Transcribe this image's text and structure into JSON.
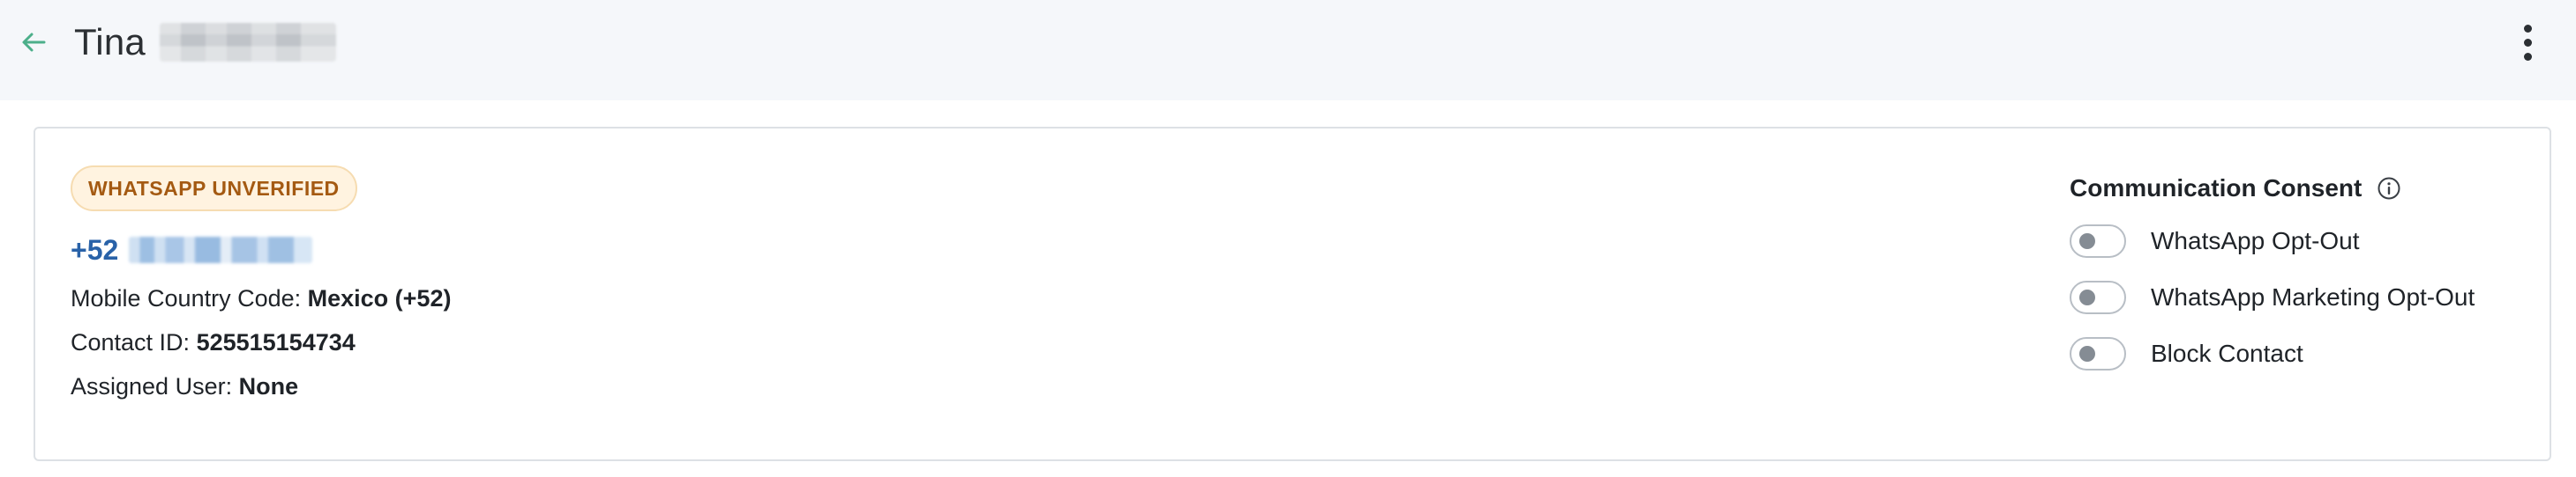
{
  "header": {
    "first_name": "Tina",
    "back_icon": "arrow-left-icon",
    "menu_icon": "more-vertical-icon",
    "accent_color": "#4caf8a"
  },
  "contact": {
    "status_badge": "WHATSAPP UNVERIFIED",
    "phone_prefix": "+52",
    "fields": {
      "mobile_country_code_label": "Mobile Country Code:",
      "mobile_country_code_value": "Mexico (+52)",
      "contact_id_label": "Contact ID:",
      "contact_id_value": "525515154734",
      "assigned_user_label": "Assigned User:",
      "assigned_user_value": "None"
    }
  },
  "consent": {
    "title": "Communication Consent",
    "info_icon": "info-circle-icon",
    "toggles": [
      {
        "label": "WhatsApp Opt-Out",
        "checked": false
      },
      {
        "label": "WhatsApp Marketing Opt-Out",
        "checked": false
      },
      {
        "label": "Block Contact",
        "checked": false
      }
    ]
  },
  "colors": {
    "header_bg": "#f5f7fa",
    "badge_bg": "#fff3e0",
    "badge_text": "#a45a12",
    "phone_link": "#2962a8"
  }
}
